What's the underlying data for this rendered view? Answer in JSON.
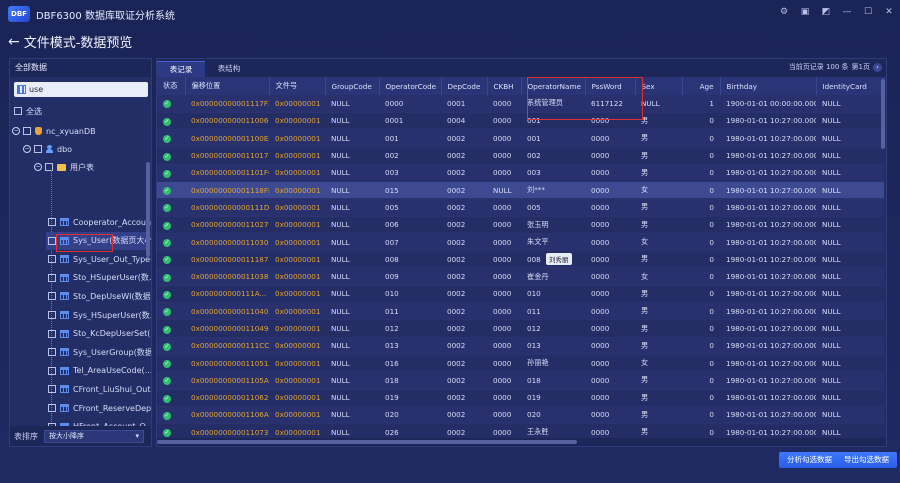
{
  "app": {
    "logo_text": "DBF",
    "title": "DBF6300 数据库取证分析系统"
  },
  "page": {
    "title": "文件模式-数据预览"
  },
  "left_panel": {
    "header": "全部数据",
    "search_value": "use",
    "select_all_label": "全选",
    "tree": {
      "database": "nc_xyuanDB",
      "schema": "dbo",
      "folder": "用户表",
      "tables": [
        "Cooperator_Accoun...",
        "Sys_User(数据页大小...",
        "Sys_User_Out_Type(...",
        "Sto_HSuperUser(数...",
        "Sto_DepUseWI(数据...",
        "Sys_HSuperUser(数...",
        "Sto_KcDepUserSet(...",
        "Sys_UserGroup(数据...",
        "Tel_AreaUseCode(...",
        "CFront_LiuShui_Out...",
        "CFront_ReserveDep...",
        "HFront_Account_O...",
        "HFront_Account_O..."
      ]
    },
    "sort_label": "表排序",
    "sort_value": "按大小降序"
  },
  "main": {
    "tabs": [
      "表记录",
      "表结构"
    ],
    "page_info": {
      "records": "当前页记录 100 条",
      "page": "第1页"
    },
    "columns": [
      "状态",
      "偏移位置",
      "文件号",
      "GroupCode",
      "OperatorCode",
      "DepCode",
      "CKBH",
      "OperatorName",
      "PssWord",
      "Sex",
      "Age",
      "Birthday",
      "IdentityCard"
    ],
    "rows": [
      [
        "0x00000000001117F2",
        "0x00000001",
        "NULL",
        "0000",
        "0001",
        "0000",
        "系统管理员",
        "6117122",
        "NULL",
        "1",
        "1900-01-01 00:00:00.000",
        "NULL"
      ],
      [
        "0x0000000000110060",
        "0x00000001",
        "NULL",
        "0001",
        "0004",
        "0000",
        "001",
        "0000",
        "男",
        "0",
        "1980-01-01 10:27:00.000",
        "NULL"
      ],
      [
        "0x00000000001100EA",
        "0x00000001",
        "NULL",
        "001",
        "0002",
        "0000",
        "001",
        "0000",
        "男",
        "0",
        "1980-01-01 10:27:00.000",
        "NULL"
      ],
      [
        "0x0000000000110170",
        "0x00000001",
        "NULL",
        "002",
        "0002",
        "0000",
        "002",
        "0000",
        "男",
        "0",
        "1980-01-01 10:27:00.000",
        "NULL"
      ],
      [
        "0x00000000001101F6",
        "0x00000001",
        "NULL",
        "003",
        "0002",
        "0000",
        "003",
        "0000",
        "男",
        "0",
        "1980-01-01 10:27:00.000",
        "NULL"
      ],
      [
        "0x00000000001118FE",
        "0x00000001",
        "NULL",
        "015",
        "0002",
        "NULL",
        "刘***",
        "0000",
        "女",
        "0",
        "1980-01-01 10:27:00.000",
        "NULL"
      ],
      [
        "0x00000000000111D...",
        "0x00000001",
        "NULL",
        "005",
        "0002",
        "0000",
        "005",
        "0000",
        "男",
        "0",
        "1980-01-01 10:27:00.000",
        "NULL"
      ],
      [
        "0x000000000011027C",
        "0x00000001",
        "NULL",
        "006",
        "0002",
        "0000",
        "张玉明",
        "0000",
        "男",
        "0",
        "1980-01-01 10:27:00.000",
        "NULL"
      ],
      [
        "0x0000000000110302",
        "0x00000001",
        "NULL",
        "007",
        "0002",
        "0000",
        "朱文平",
        "0000",
        "女",
        "0",
        "1980-01-01 10:27:00.000",
        "NULL"
      ],
      [
        "0x0000000000111878",
        "0x00000001",
        "NULL",
        "008",
        "0002",
        "0000",
        "008",
        "0000",
        "男",
        "0",
        "1980-01-01 10:27:00.000",
        "NULL"
      ],
      [
        "0x0000000000110388",
        "0x00000001",
        "NULL",
        "009",
        "0002",
        "0000",
        "崔金丹",
        "0000",
        "女",
        "0",
        "1980-01-01 10:27:00.000",
        "NULL"
      ],
      [
        "0x000000000111A...",
        "0x00000001",
        "NULL",
        "010",
        "0002",
        "0000",
        "010",
        "0000",
        "男",
        "0",
        "1980-01-01 10:27:00.000",
        "NULL"
      ],
      [
        "0x000000000011040E",
        "0x00000001",
        "NULL",
        "011",
        "0002",
        "0000",
        "011",
        "0000",
        "男",
        "0",
        "1980-01-01 10:27:00.000",
        "NULL"
      ],
      [
        "0x0000000000110494",
        "0x00000001",
        "NULL",
        "012",
        "0002",
        "0000",
        "012",
        "0000",
        "男",
        "0",
        "1980-01-01 10:27:00.000",
        "NULL"
      ],
      [
        "0x0000000000111CC4",
        "0x00000001",
        "NULL",
        "013",
        "0002",
        "0000",
        "013",
        "0000",
        "男",
        "0",
        "1980-01-01 10:27:00.000",
        "NULL"
      ],
      [
        "0x000000000011051A",
        "0x00000001",
        "NULL",
        "016",
        "0002",
        "0000",
        "孙丽艳",
        "0000",
        "女",
        "0",
        "1980-01-01 10:27:00.000",
        "NULL"
      ],
      [
        "0x00000000001105A0",
        "0x00000001",
        "NULL",
        "018",
        "0002",
        "0000",
        "018",
        "0000",
        "男",
        "0",
        "1980-01-01 10:27:00.000",
        "NULL"
      ],
      [
        "0x0000000000110626",
        "0x00000001",
        "NULL",
        "019",
        "0002",
        "0000",
        "019",
        "0000",
        "男",
        "0",
        "1980-01-01 10:27:00.000",
        "NULL"
      ],
      [
        "0x00000000001106AC",
        "0x00000001",
        "NULL",
        "020",
        "0002",
        "0000",
        "020",
        "0000",
        "男",
        "0",
        "1980-01-01 10:27:00.000",
        "NULL"
      ],
      [
        "0x0000000000110732",
        "0x00000001",
        "NULL",
        "026",
        "0002",
        "0000",
        "王永胜",
        "0000",
        "男",
        "0",
        "1980-01-01 10:27:00.000",
        "NULL"
      ]
    ],
    "tooltip": "刘秀丽"
  },
  "buttons": {
    "analyze": "分析勾选数据",
    "export": "导出勾选数据"
  }
}
